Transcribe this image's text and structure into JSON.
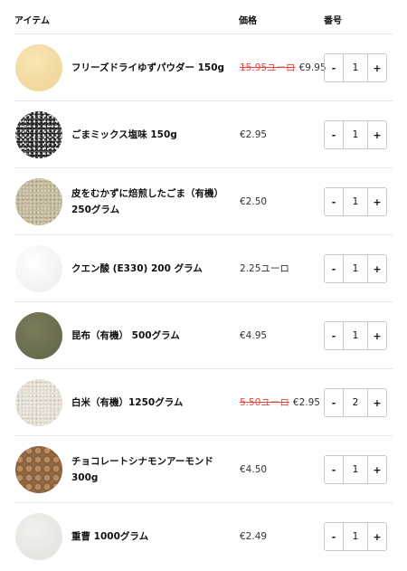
{
  "header": {
    "item_label": "アイテム",
    "price_label": "価格",
    "qty_label": "番号"
  },
  "stepper": {
    "minus": "-",
    "plus": "+"
  },
  "items": [
    {
      "name": "フリーズドライゆずパウダー 150g",
      "old_price": "15.95ユーロ",
      "price": "€9.95",
      "qty": "1",
      "image": "yuzu-powder"
    },
    {
      "name": "ごまミックス塩味 150g",
      "old_price": "",
      "price": "€2.95",
      "qty": "1",
      "image": "sesame-salt-mix"
    },
    {
      "name": "皮をむかずに焙煎したごま（有機） 250グラム",
      "old_price": "",
      "price": "€2.50",
      "qty": "1",
      "image": "roasted-sesame"
    },
    {
      "name": "クエン酸 (E330) 200 グラム",
      "old_price": "",
      "price": "2.25ユーロ",
      "qty": "1",
      "image": "citric-acid"
    },
    {
      "name": "昆布（有機） 500グラム",
      "old_price": "",
      "price": "€4.95",
      "qty": "1",
      "image": "kombu-powder"
    },
    {
      "name": "白米（有機）1250グラム",
      "old_price": "5.50ユーロ",
      "price": "€2.95",
      "qty": "2",
      "image": "white-rice"
    },
    {
      "name": "チョコレートシナモンアーモンド 300g",
      "old_price": "",
      "price": "€4.50",
      "qty": "1",
      "image": "chocolate-almonds"
    },
    {
      "name": "重曹 1000グラム",
      "old_price": "",
      "price": "€2.49",
      "qty": "1",
      "image": "baking-soda"
    }
  ],
  "colors": {
    "sale_price": "#e5453c",
    "divider": "#e6e6e6",
    "stepper_border": "#c8c8c8"
  }
}
